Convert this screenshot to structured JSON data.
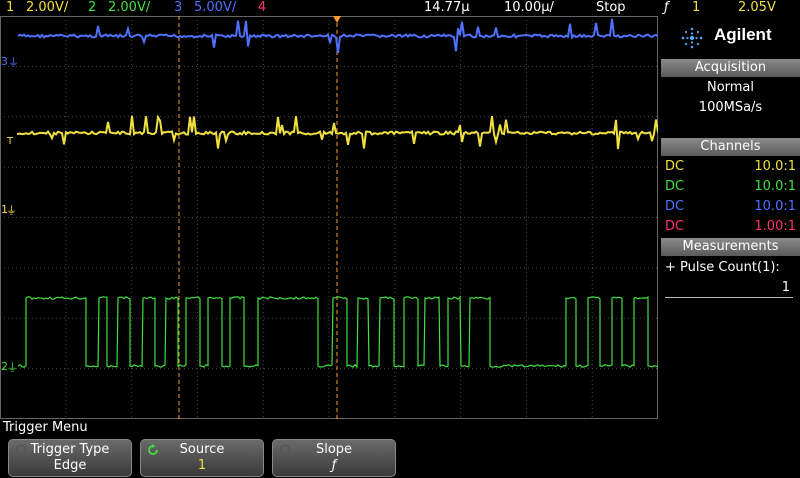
{
  "status_bar": {
    "ch1_num": "1",
    "ch1_scale": "2.00V/",
    "ch2_num": "2",
    "ch2_scale": "2.00V/",
    "ch3_num": "3",
    "ch3_scale": "5.00V/",
    "ch4_num": "4",
    "time_pos": "14.77µ",
    "time_div": "10.00µ/",
    "run_state": "Stop",
    "trig_slope_glyph": "ƒ",
    "trig_source": "1",
    "trig_level": "2.05V"
  },
  "markers": {
    "ch3": "3",
    "trig_level": "T",
    "ch1": "1",
    "ch2": "2"
  },
  "panel": {
    "brand": "Agilent",
    "acquisition_title": "Acquisition",
    "acq_mode": "Normal",
    "acq_rate": "100MSa/s",
    "channels_title": "Channels",
    "channels": [
      {
        "coupling": "DC",
        "probe": "10.0:1",
        "color": "#f0e040"
      },
      {
        "coupling": "DC",
        "probe": "10.0:1",
        "color": "#40e040"
      },
      {
        "coupling": "DC",
        "probe": "10.0:1",
        "color": "#5070ff"
      },
      {
        "coupling": "DC",
        "probe": "1.00:1",
        "color": "#ff3070"
      }
    ],
    "measurements_title": "Measurements",
    "measurement_label": "+ Pulse Count(1):",
    "measurement_value": "1"
  },
  "menu": {
    "title": "Trigger Menu",
    "keys": [
      {
        "label": "Trigger Type",
        "value": "Edge"
      },
      {
        "label": "Source",
        "value": "1"
      },
      {
        "label": "Slope",
        "value": "ƒ"
      }
    ]
  },
  "colors": {
    "ch1": "#f0e040",
    "ch2": "#40e040",
    "ch3": "#5070ff",
    "ch4": "#ff3070",
    "grid": "#4a4a4a",
    "cursor": "#ff9a30"
  }
}
